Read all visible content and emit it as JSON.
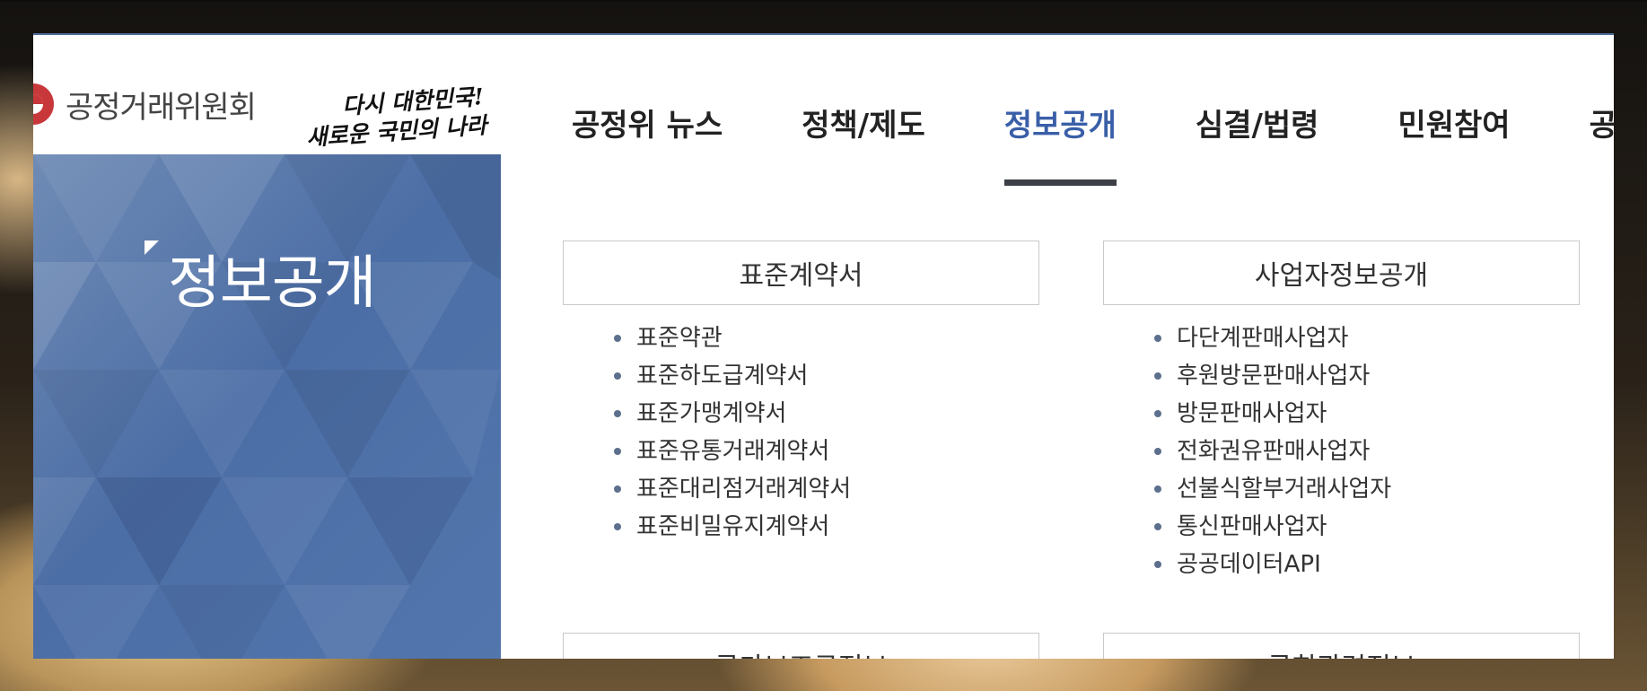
{
  "header": {
    "org_name": "공정거래위원회",
    "slogan_line1": "다시 대한민국!",
    "slogan_line2": "새로운 국민의 나라"
  },
  "nav": {
    "items": [
      {
        "label": "공정위 뉴스"
      },
      {
        "label": "정책/제도"
      },
      {
        "label": "정보공개",
        "active": true
      },
      {
        "label": "심결/법령"
      },
      {
        "label": "민원참여"
      },
      {
        "label": "공정위 소"
      }
    ]
  },
  "side": {
    "title": "정보공개"
  },
  "sections": [
    {
      "title": "표준계약서",
      "items": [
        "표준약관",
        "표준하도급계약서",
        "표준가맹계약서",
        "표준유통거래계약서",
        "표준대리점거래계약서",
        "표준비밀유지계약서"
      ]
    },
    {
      "title": "사업자정보공개",
      "items": [
        "다단계판매사업자",
        "후원방문판매사업자",
        "방문판매사업자",
        "전화권유판매사업자",
        "선불식할부거래사업자",
        "통신판매사업자",
        "공공데이터API"
      ]
    },
    {
      "title": "국가보조금정보"
    },
    {
      "title": "국회관련정보"
    }
  ],
  "colors": {
    "accent": "#3a5fa8",
    "nav_underline": "#3c3f46",
    "side_panel": "#5276ad",
    "bullet": "#5c6f8c"
  }
}
